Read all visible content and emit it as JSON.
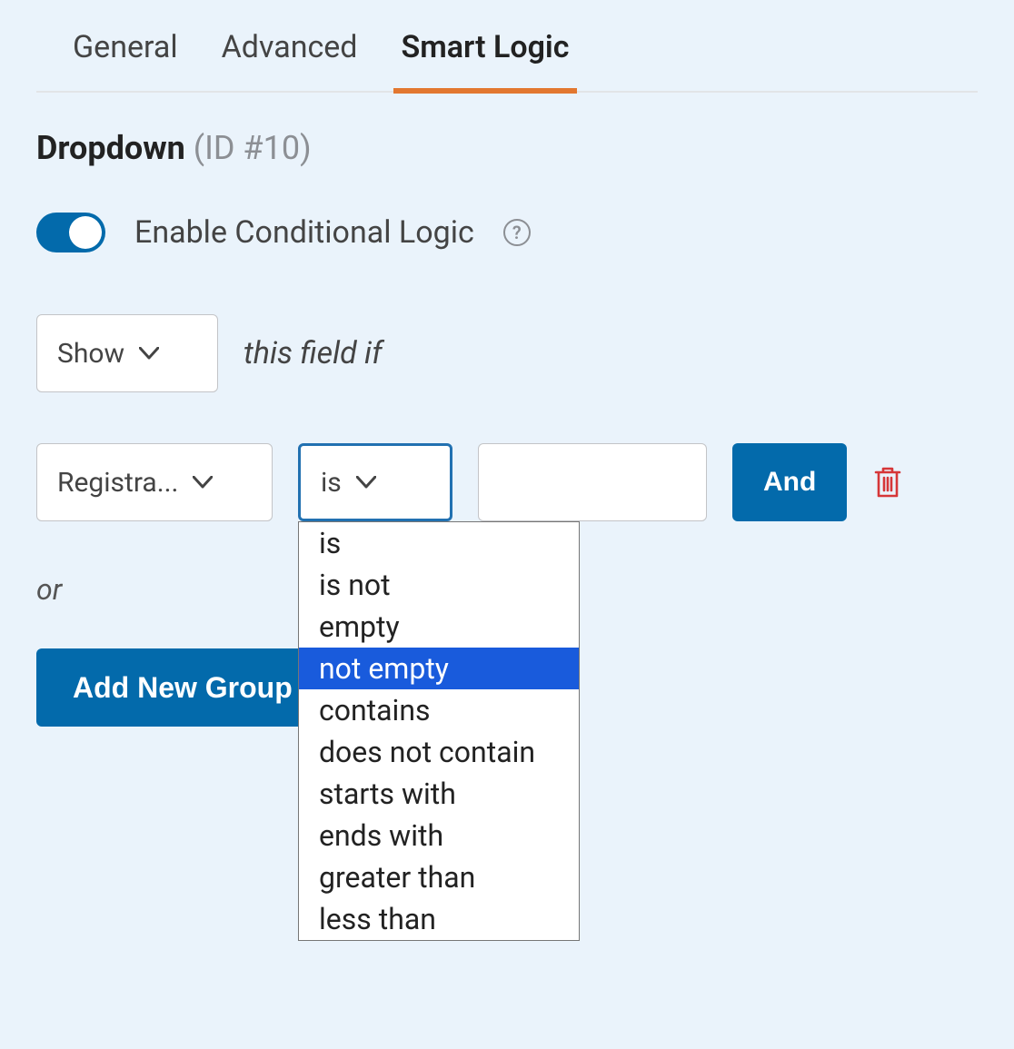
{
  "tabs": {
    "general": "General",
    "advanced": "Advanced",
    "smart_logic": "Smart Logic",
    "active": "smart_logic"
  },
  "heading": {
    "field_name": "Dropdown",
    "field_id": "(ID #10)"
  },
  "toggle": {
    "label": "Enable Conditional Logic",
    "on": true,
    "help_glyph": "?"
  },
  "action_select": {
    "value": "Show"
  },
  "action_suffix": "this field if",
  "rule": {
    "field_select": {
      "value": "Registra..."
    },
    "operator_select": {
      "value": "is"
    },
    "value_input": {
      "value": ""
    },
    "and_button": "And"
  },
  "operator_options": {
    "items": [
      "is",
      "is not",
      "empty",
      "not empty",
      "contains",
      "does not contain",
      "starts with",
      "ends with",
      "greater than",
      "less than"
    ],
    "highlighted_index": 3
  },
  "or_label": "or",
  "add_group_button": "Add New Group"
}
